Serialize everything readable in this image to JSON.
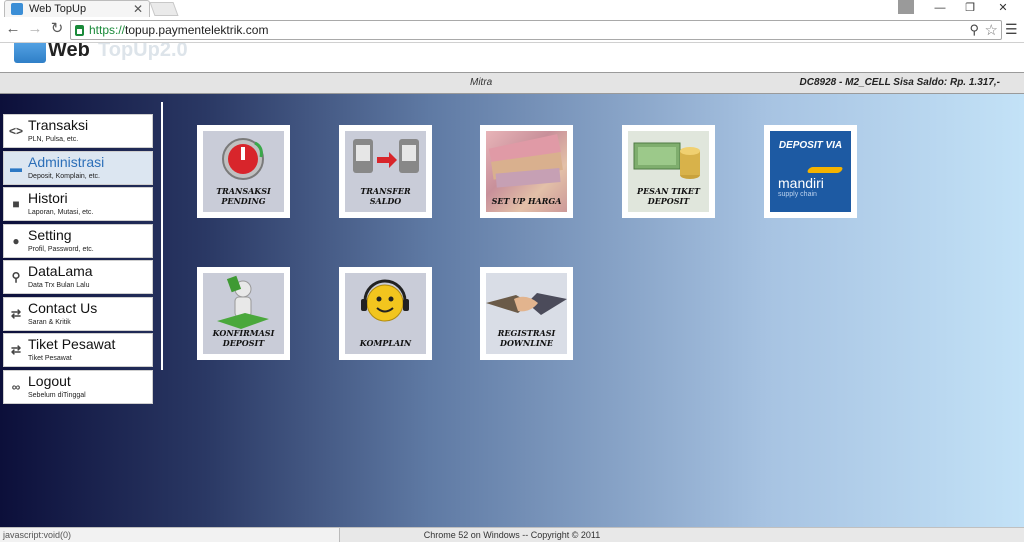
{
  "browser": {
    "tab_title": "Web TopUp",
    "url_scheme": "https://",
    "url_rest": "topup.paymentelektrik.com",
    "status_url": "javascript:void(0)"
  },
  "header": {
    "logo_text": "Web",
    "logo_sub": "TopUp2.0",
    "mitra": "Mitra",
    "saldo": "DC8928 - M2_CELL Sisa Saldo: Rp. 1.317,-"
  },
  "sidebar": {
    "items": [
      {
        "label": "Transaksi",
        "sub": "PLN, Pulsa, etc.",
        "icon": "code-icon",
        "glyph": "<>"
      },
      {
        "label": "Administrasi",
        "sub": "Deposit, Komplain, etc.",
        "icon": "folder-icon",
        "glyph": "▬"
      },
      {
        "label": "Histori",
        "sub": "Laporan, Mutasi, etc.",
        "icon": "book-icon",
        "glyph": "■"
      },
      {
        "label": "Setting",
        "sub": "Profil, Password, etc.",
        "icon": "user-icon",
        "glyph": "●"
      },
      {
        "label": "DataLama",
        "sub": "Data Trx Bulan Lalu",
        "icon": "search-icon",
        "glyph": "⚲"
      },
      {
        "label": "Contact Us",
        "sub": "Saran & Kritik",
        "icon": "exchange-icon",
        "glyph": "⇄"
      },
      {
        "label": "Tiket Pesawat",
        "sub": "Tiket Pesawat",
        "icon": "exchange-icon",
        "glyph": "⇄"
      },
      {
        "label": "Logout",
        "sub": "Sebelum diTinggal",
        "icon": "link-icon",
        "glyph": "∞"
      }
    ]
  },
  "tiles": [
    {
      "caption": "TRANSAKSI PENDING"
    },
    {
      "caption": "TRANSFER SALDO"
    },
    {
      "caption": "SET UP HARGA"
    },
    {
      "caption": "PESAN TIKET DEPOSIT"
    },
    {
      "caption": "DEPOSIT VIA",
      "brand": "mandiri",
      "brand_sub": "supply chain"
    },
    {
      "caption": "KONFIRMASI DEPOSIT"
    },
    {
      "caption": "KOMPLAIN"
    },
    {
      "caption": "REGISTRASI DOWNLINE"
    }
  ],
  "footer": {
    "text": "Chrome 52 on Windows -- Copyright © 2011"
  },
  "colors": {
    "accent": "#2c6fb8",
    "secure": "#1a8a3a"
  }
}
